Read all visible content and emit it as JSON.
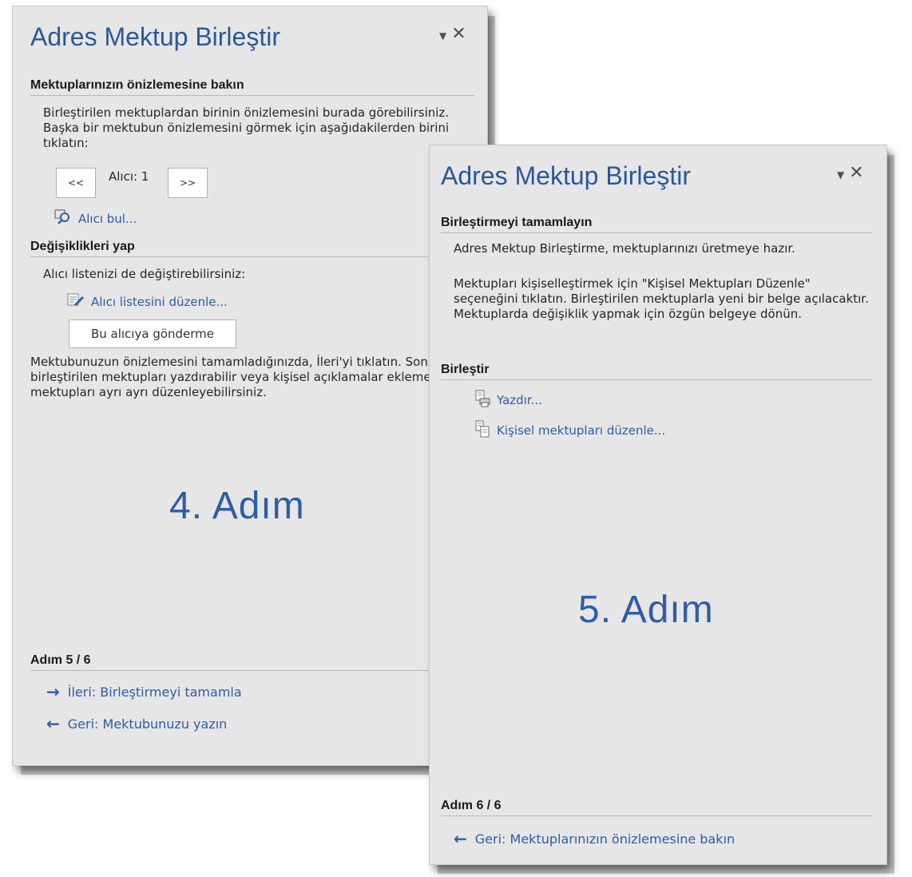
{
  "pane4": {
    "title": "Adres Mektup Birleştir",
    "section_preview": "Mektuplarınızın önizlemesine bakın",
    "preview_text": "Birleştirilen mektuplardan birinin önizlemesini burada görebilirsiniz. Başka bir mektubun önizlemesini görmek için aşağıdakilerden birini tıklatın:",
    "prev_button": "<<",
    "recipient_label": "Alıcı: 1",
    "next_button": ">>",
    "find_recipient": "Alıcı bul...",
    "section_changes": "Değişiklikleri yap",
    "changes_text": "Alıcı listenizi de değiştirebilirsiniz:",
    "edit_list": "Alıcı listesini düzenle...",
    "exclude_button": "Bu alıcıya gönderme",
    "finish_text": "Mektubunuzun önizlemesini tamamladığınızda, İleri'yi tıklatın. Sonra, birleştirilen mektupları yazdırabilir veya kişisel açıklamalar eklemek üzere mektupları ayrı ayrı düzenleyebilirsiniz.",
    "step_overlay": "4. Adım",
    "step_label": "Adım 5 / 6",
    "next_link": "İleri: Birleştirmeyi tamamla",
    "back_link": "Geri: Mektubunuzu yazın"
  },
  "pane5": {
    "title": "Adres Mektup Birleştir",
    "section_complete": "Birleştirmeyi tamamlayın",
    "ready_text": "Adres Mektup Birleştirme, mektuplarınızı üretmeye hazır.",
    "personalize_text": "Mektupları kişiselleştirmek için \"Kişisel Mektupları Düzenle\" seçeneğini tıklatın. Birleştirilen mektuplarla yeni bir belge açılacaktır. Mektuplarda değişiklik yapmak için özgün belgeye dönün.",
    "section_merge": "Birleştir",
    "print_link": "Yazdır...",
    "edit_letters_link": "Kişisel mektupları düzenle...",
    "step_overlay": "5. Adım",
    "step_label": "Adım 6 / 6",
    "back_link": "Geri: Mektuplarınızın önizlemesine bakın"
  },
  "colors": {
    "title_blue": "#2b579a",
    "link_blue": "#2e5ca8",
    "pane_bg": "#e6e6e6"
  },
  "icons": [
    "dropdown-arrow-icon",
    "close-icon",
    "magnifier-icon",
    "edit-list-icon",
    "print-icon",
    "edit-letters-icon",
    "arrow-right-icon",
    "arrow-left-icon"
  ]
}
